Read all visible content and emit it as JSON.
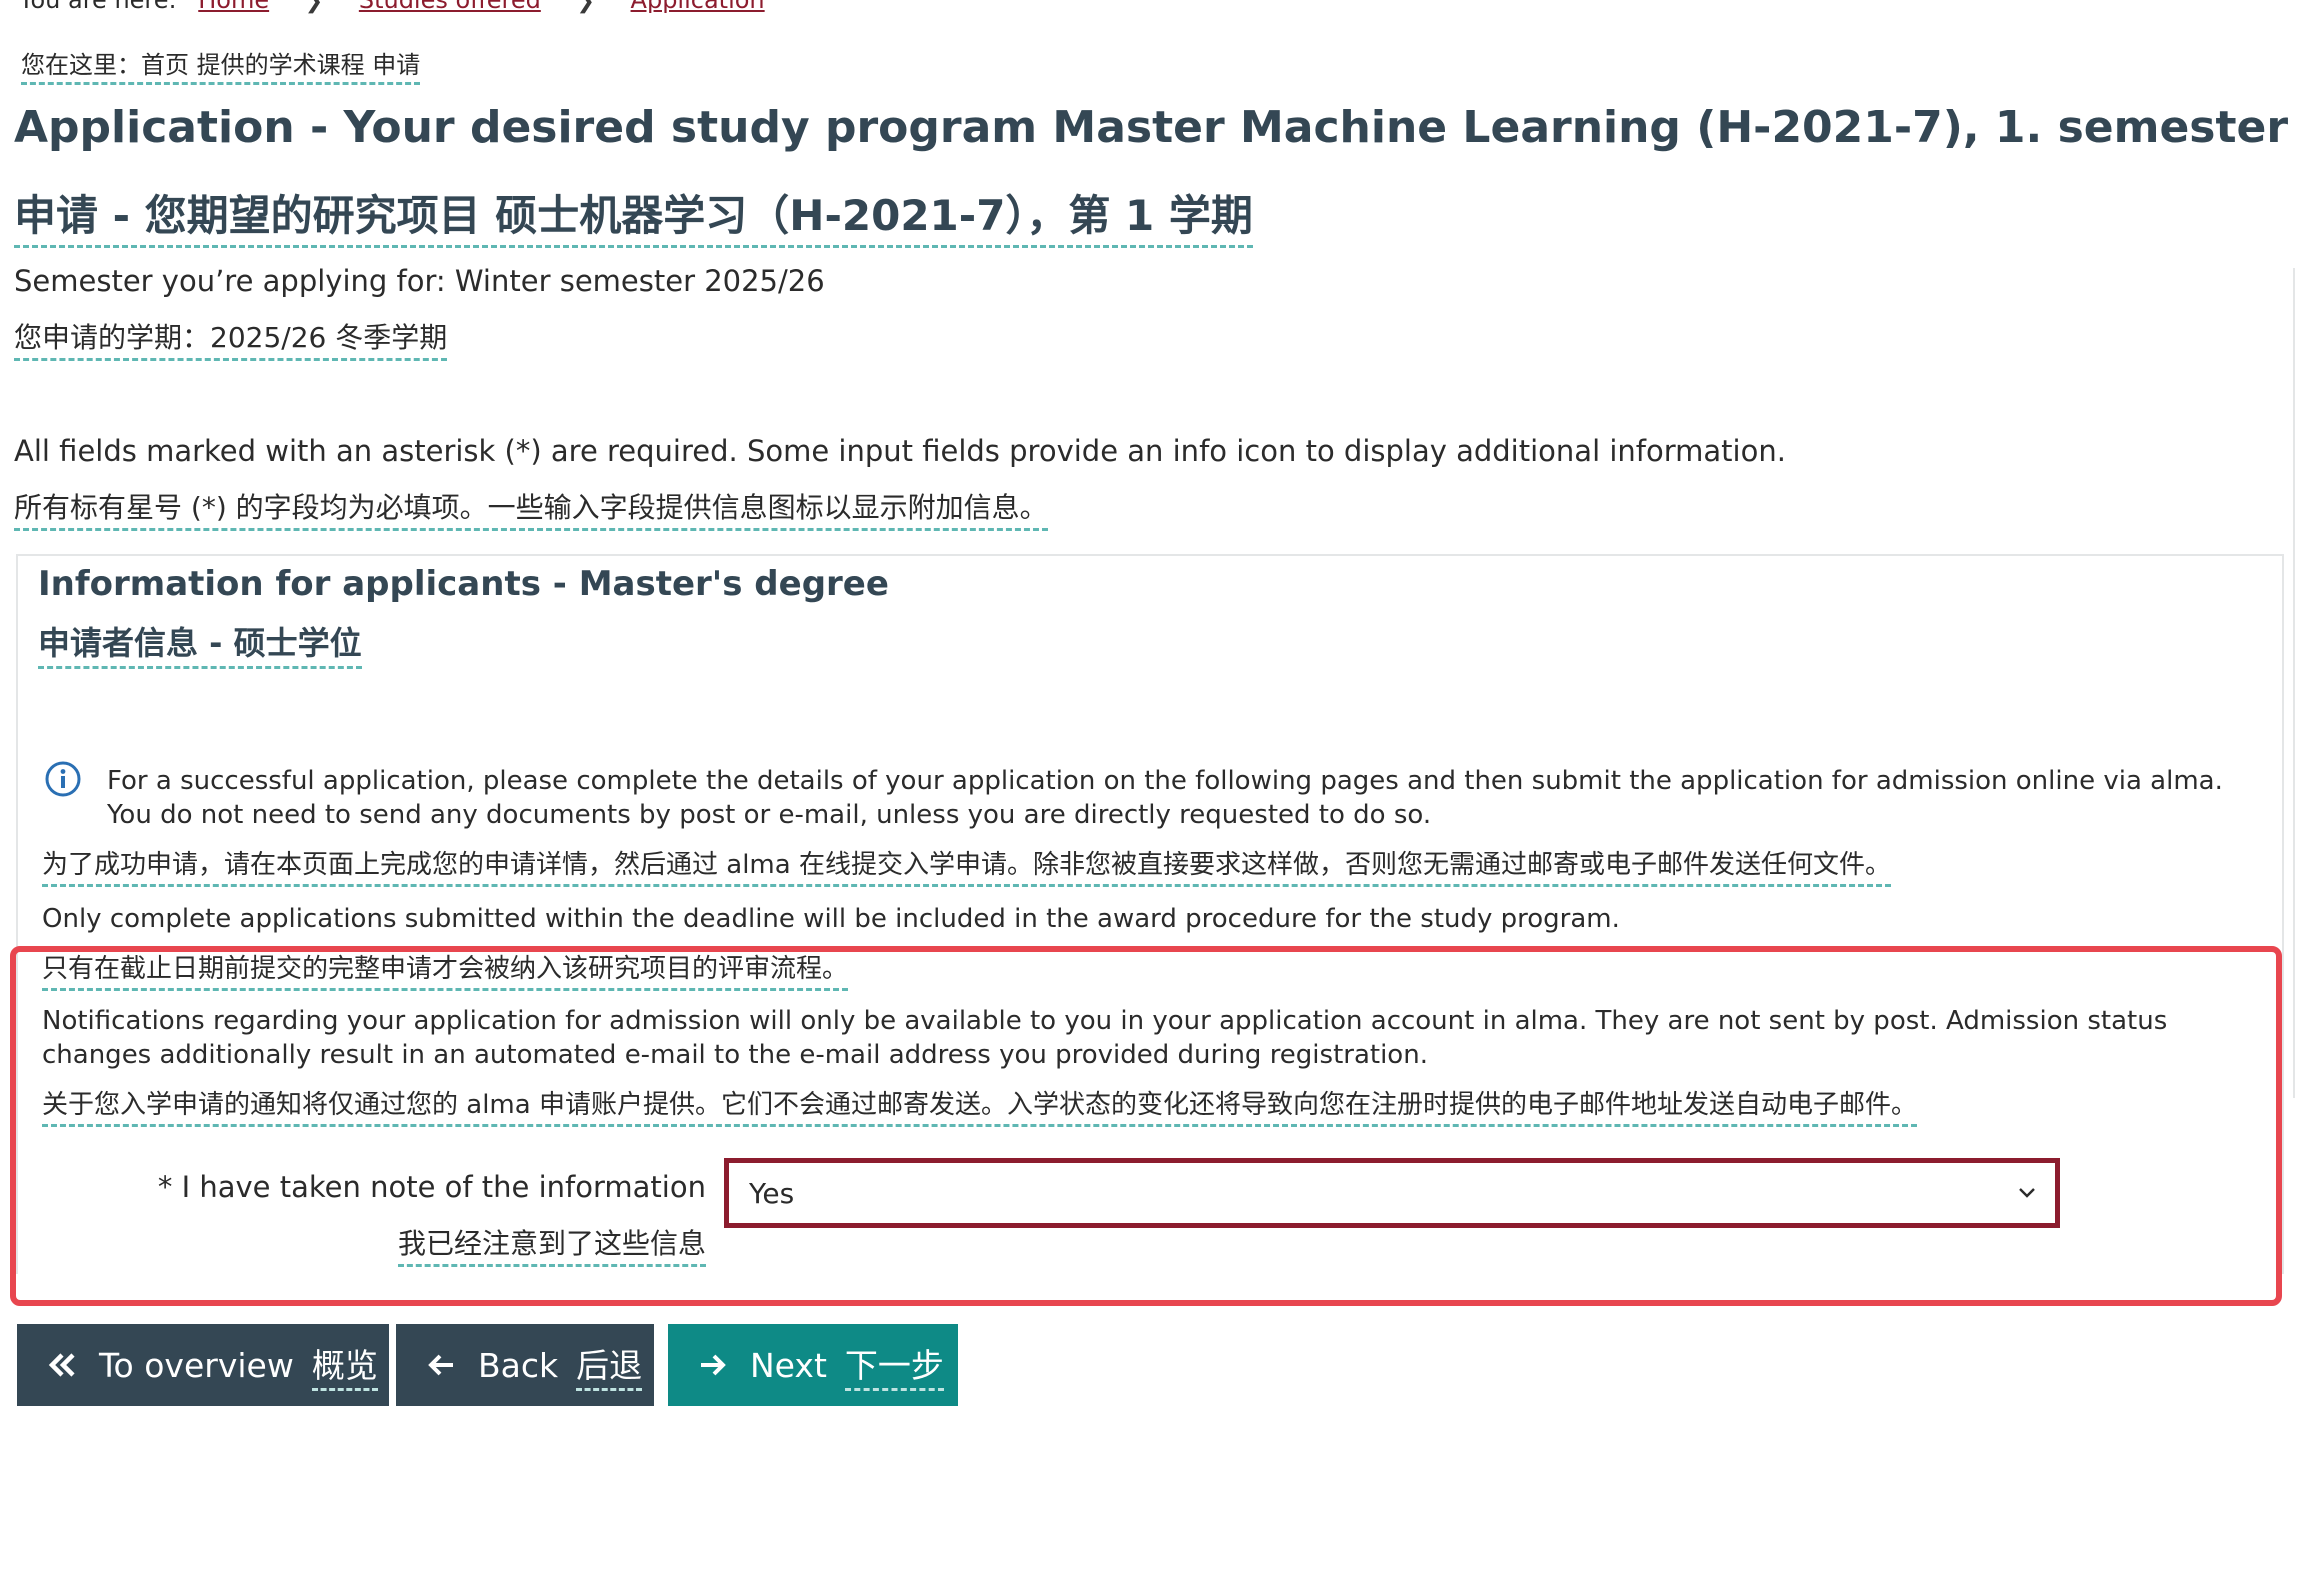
{
  "breadcrumb": {
    "prefix": "You are here:",
    "items": [
      "Home",
      "Studies offered",
      "Application"
    ],
    "translation": "您在这里：首页 提供的学术课程 申请"
  },
  "title": {
    "en": "Application - Your desired study program Master Machine Learning (H-2021-7), 1. semester",
    "zh": "申请 - 您期望的研究项目 硕士机器学习（H-2021-7），第 1 学期"
  },
  "semester": {
    "en": "Semester you’re applying for: Winter semester 2025/26",
    "zh": "您申请的学期：2025/26 冬季学期"
  },
  "required_note": {
    "en": "All fields marked with an asterisk (*) are required. Some input fields provide an info icon to display additional information.",
    "zh": "所有标有星号 (*) 的字段均为必填项。一些输入字段提供信息图标以显示附加信息。"
  },
  "panel": {
    "title_en": "Information for applicants - Master's degree",
    "title_zh": "申请者信息 - 硕士学位",
    "info_icon": "info-circle-icon",
    "paragraphs": [
      {
        "en": "For a successful application, please complete the details of your application on the following pages and then submit the application for admission online via alma. You do not need to send any documents by post or e-mail, unless you are directly requested to do so.",
        "zh": "为了成功申请，请在本页面上完成您的申请详情，然后通过 alma 在线提交入学申请。除非您被直接要求这样做，否则您无需通过邮寄或电子邮件发送任何文件。"
      },
      {
        "en": "Only complete applications submitted within the deadline will be included in the award procedure for the study program.",
        "zh": "只有在截止日期前提交的完整申请才会被纳入该研究项目的评审流程。"
      },
      {
        "en": "Notifications regarding your application for admission will only be available to you in your application account in alma. They are not sent by post. Admission status changes additionally result in an automated e-mail to the e-mail address you provided during registration.",
        "zh": "关于您入学申请的通知将仅通过您的 alma 申请账户提供。它们不会通过邮寄发送。入学状态的变化还将导致向您在注册时提供的电子邮件地址发送自动电子邮件。"
      }
    ],
    "field": {
      "label_en": "* I have taken note of the information",
      "label_zh": "我已经注意到了这些信息",
      "value": "Yes"
    }
  },
  "buttons": {
    "overview": {
      "label": "To overview",
      "zh": "概览",
      "icon": "double-chevron-left-icon"
    },
    "back": {
      "label": "Back",
      "zh": "后退",
      "icon": "arrow-left-icon"
    },
    "next": {
      "label": "Next",
      "zh": "下一步",
      "icon": "arrow-right-icon"
    }
  },
  "colors": {
    "heading": "#344754",
    "link": "#8c1c2e",
    "primary_button": "#0e8a86",
    "secondary_button": "#344754",
    "highlight": "#e8464f",
    "translation_underline": "#5fb7b3"
  }
}
